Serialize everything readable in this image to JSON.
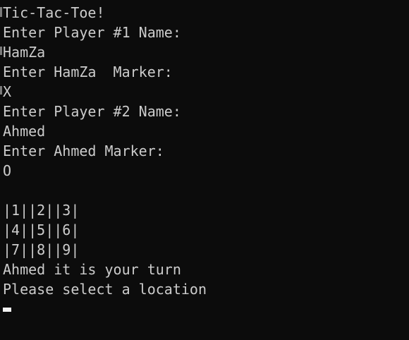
{
  "terminal": {
    "lines": [
      "Tic-Tac-Toe!",
      "Enter Player #1 Name:",
      "HamZa",
      "Enter HamZa  Marker:",
      "X",
      "Enter Player #2 Name:",
      "Ahmed",
      "Enter Ahmed Marker:",
      "O",
      "",
      "|1||2||3|",
      "|4||5||6|",
      "|7||8||9|",
      "Ahmed it is your turn",
      "Please select a location"
    ]
  },
  "colors": {
    "background": "#0c0c0c",
    "text": "#cccccc",
    "cursor": "#f2f2f2"
  }
}
